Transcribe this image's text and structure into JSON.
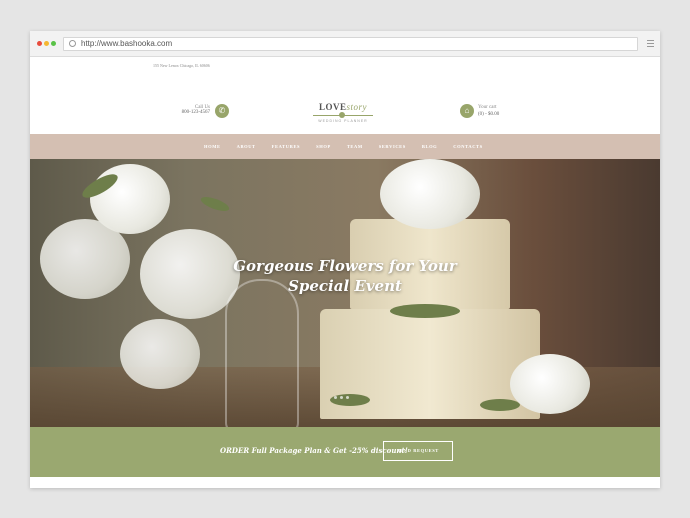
{
  "browser": {
    "url": "http://www.bashooka.com",
    "dots": [
      "#e84c3d",
      "#f5b731",
      "#59c247"
    ]
  },
  "site": {
    "address": "155 New Lenox Chicago, IL 60606",
    "call": {
      "label": "Call Us",
      "number": "800-123-4567"
    },
    "logo": {
      "name_bold": "LOVE",
      "name_italic": "story",
      "tagline": "WEDDING PLANNER"
    },
    "cart": {
      "label": "Your cart",
      "value": "(0) - $0.00"
    },
    "nav": [
      "HOME",
      "ABOUT",
      "FEATURES",
      "SHOP",
      "TEAM",
      "SERVICES",
      "BLOG",
      "CONTACTS"
    ],
    "hero": {
      "line1": "Gorgeous Flowers for Your",
      "line2": "Special Event"
    },
    "promo": {
      "text": "ORDER Full Package Plan & Get -25% discount!",
      "button": "SEND REQUEST"
    }
  },
  "colors": {
    "accent": "#98a56a",
    "nav_bg": "#d4bfb2",
    "promo_bg": "#9aa870"
  }
}
